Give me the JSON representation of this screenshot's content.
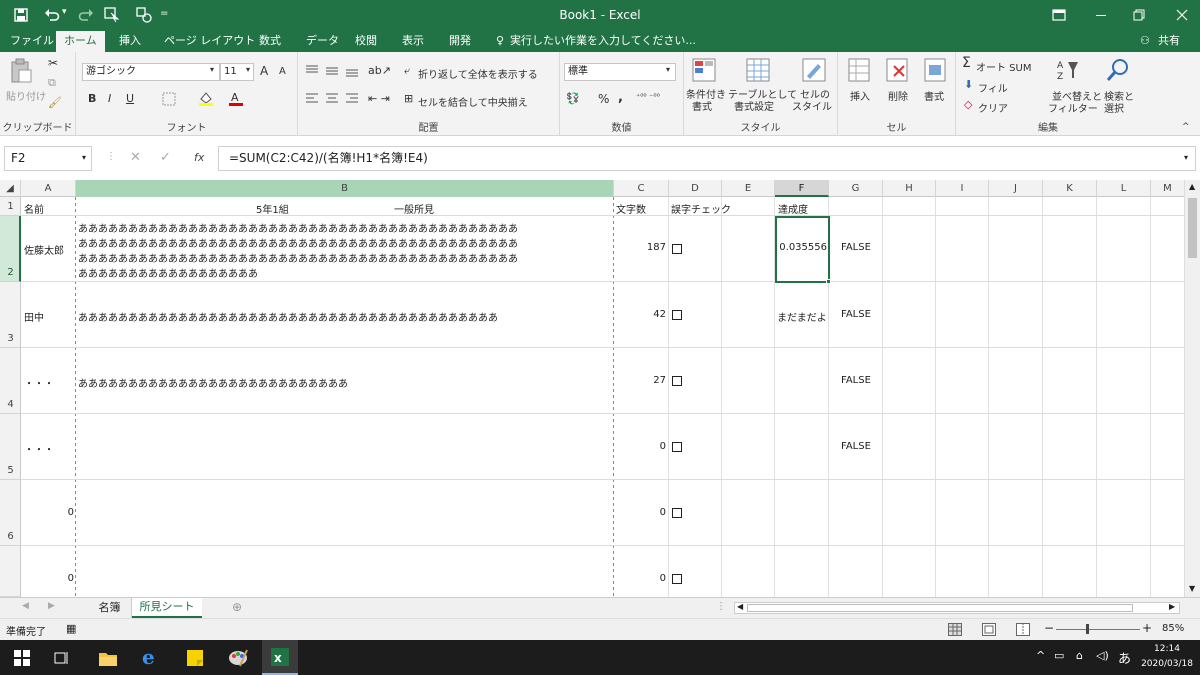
{
  "title": "Book1 - Excel",
  "qat": {
    "save_icon": "save-icon",
    "undo_icon": "undo-icon",
    "redo_icon": "redo-icon"
  },
  "tabs": [
    "ファイル",
    "ホーム",
    "挿入",
    "ページ レイアウト",
    "数式",
    "データ",
    "校閲",
    "表示",
    "開発"
  ],
  "tell_me": "実行したい作業を入力してください...",
  "share": "共有",
  "ribbon": {
    "clipboard": {
      "paste": "貼り付け",
      "label": "クリップボード"
    },
    "font": {
      "name": "游ゴシック",
      "size": "11",
      "grow": "A",
      "shrink": "A",
      "bold": "B",
      "italic": "I",
      "underline": "U",
      "label": "フォント"
    },
    "align": {
      "wrap": "折り返して全体を表示する",
      "merge": "セルを結合して中央揃え",
      "label": "配置"
    },
    "number": {
      "format": "標準",
      "percent": "%",
      "comma": ",",
      "label": "数値"
    },
    "styles": {
      "cond": "条件付き",
      "cond2": "書式",
      "table": "テーブルとして",
      "table2": "書式設定",
      "cell": "セルの",
      "cell2": "スタイル",
      "label": "スタイル"
    },
    "cells": {
      "insert": "挿入",
      "delete": "削除",
      "format": "書式",
      "label": "セル"
    },
    "edit": {
      "autosum": "オート SUM",
      "fill": "フィル",
      "clear": "クリア",
      "sort": "並べ替えと",
      "sort2": "フィルター",
      "find": "検索と",
      "find2": "選択",
      "label": "編集"
    }
  },
  "namebox": "F2",
  "formula": "=SUM(C2:C42)/(名簿!H1*名簿!E4)",
  "fx": "fx",
  "columns": [
    "A",
    "B",
    "C",
    "D",
    "E",
    "F",
    "G",
    "H",
    "I",
    "J",
    "K",
    "L",
    "M"
  ],
  "header_row": {
    "a": "名前",
    "b1": "5年1組",
    "b2": "一般所見",
    "c": "文字数",
    "d": "誤字チェック",
    "f": "達成度"
  },
  "rows": [
    {
      "num": "2",
      "a": "佐藤太郎",
      "b": [
        "ああああああああああああああああああああああああああああああああああああああああああああ",
        "ああああああああああああああああああああああああああああああああああああああああああああ",
        "ああああああああああああああああああああああああああああああああああああああああああああ",
        "ああああああああああああああああああ"
      ],
      "c": "187",
      "f": "0.035556",
      "g": "FALSE"
    },
    {
      "num": "3",
      "a": "田中",
      "b": [
        "ああああああああああああああああああああああああああああああああああああああああああ"
      ],
      "c": "42",
      "f": "まだまだよ",
      "g": "FALSE"
    },
    {
      "num": "4",
      "a": "・・・",
      "b": [
        "あああああああああああああああああああああああああああ"
      ],
      "c": "27",
      "f": "",
      "g": "FALSE"
    },
    {
      "num": "5",
      "a": "・・・",
      "b": [
        ""
      ],
      "c": "0",
      "f": "",
      "g": "FALSE"
    },
    {
      "num": "6",
      "a": "0",
      "b": [
        ""
      ],
      "c": "0",
      "f": "",
      "g": ""
    },
    {
      "num": "",
      "a": "0",
      "b": [
        ""
      ],
      "c": "0",
      "f": "",
      "g": ""
    }
  ],
  "sheets": [
    "名簿",
    "所見シート"
  ],
  "status": {
    "ready": "準備完了",
    "zoom": "85%"
  },
  "taskbar": {
    "time": "12:14",
    "date": "2020/03/18",
    "ime": "あ"
  },
  "colors": {
    "excel_green": "#217346",
    "selected_header": "#a8d5b5"
  }
}
